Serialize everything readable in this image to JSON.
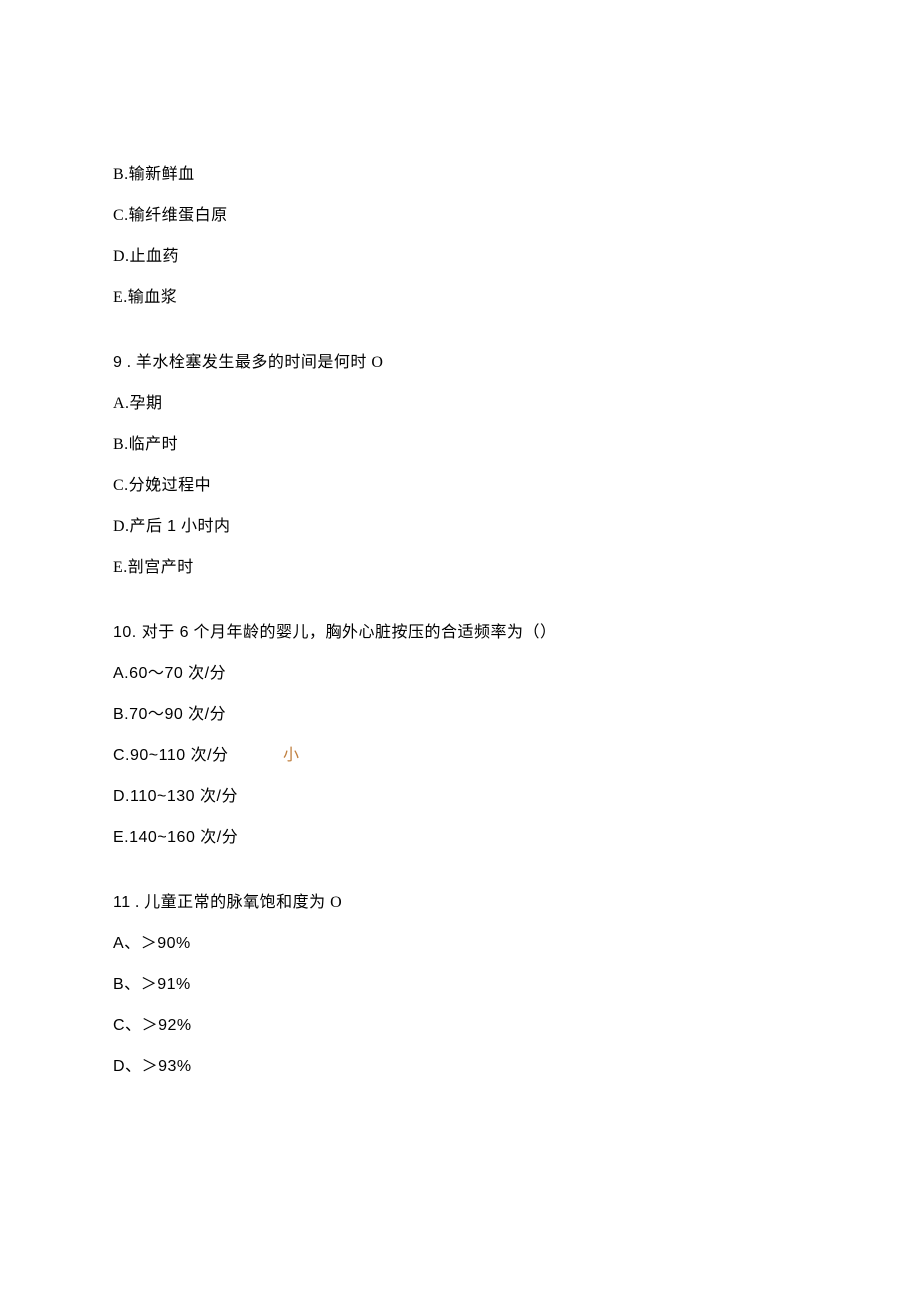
{
  "q8": {
    "B": "B.输新鲜血",
    "C": "C.输纤维蛋白原",
    "D": "D.止血药",
    "E": "E.输血浆"
  },
  "q9": {
    "stem_num": "9",
    "stem_sep": " . ",
    "stem_text": "羊水栓塞发生最多的时间是何时 O",
    "A": "A.孕期",
    "B": "B.临产时",
    "C": "C.分娩过程中",
    "D_prefix": "D.产后 ",
    "D_num": "1",
    "D_suffix": " 小时内",
    "E": "E.剖宫产时"
  },
  "q10": {
    "stem_prefix": "10. 对于 ",
    "stem_num": "6",
    "stem_suffix": " 个月年龄的婴儿，胸外心脏按压的合适频率为（）",
    "A_prefix": "A.60",
    "A_mid": "～",
    "A_suffix": "70 次/分",
    "B_prefix": "B.70",
    "B_mid": "～",
    "B_suffix": "90 次/分",
    "C_main": "C.90~110 次/分",
    "C_annot": "小",
    "D": "D.110~130 次/分",
    "E": "E.140~160 次/分"
  },
  "q11": {
    "stem_num": "11",
    "stem_sep": " . ",
    "stem_text": "儿童正常的脉氧饱和度为 O",
    "A_label": "A、",
    "A_gt": "＞",
    "A_val": "90%",
    "B_label": "B、",
    "B_gt": "＞",
    "B_val": "91%",
    "C_label": "C、",
    "C_gt": "＞",
    "C_val": "92%",
    "D_label": "D、",
    "D_gt": "＞",
    "D_val": "93%"
  }
}
